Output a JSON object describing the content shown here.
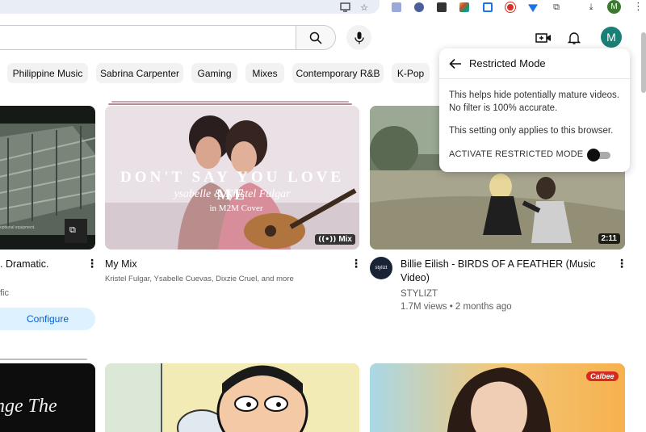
{
  "header": {
    "search_placeholder": "",
    "avatar_letter": "M",
    "profile_letter": "M"
  },
  "chips": [
    "Philippine Music",
    "Sabrina Carpenter",
    "Gaming",
    "Mixes",
    "Contemporary R&B",
    "K-Pop"
  ],
  "cards": [
    {
      "title": ". Dramatic.",
      "meta": "fic",
      "action": "Configure",
      "thumb_caption": "optional equipment."
    },
    {
      "title": "My Mix",
      "meta": "Kristel Fulgar, Ysabelle Cuevas, Dixzie Cruel, and more",
      "badge": "Mix",
      "overlay_line1": "DON'T SAY YOU LOVE ME",
      "overlay_line2": "ysabelle & Kristel Fulgar",
      "overlay_line3": "in M2M Cover"
    },
    {
      "title": "Billie Eilish - BIRDS OF A FEATHER (Music Video)",
      "channel": "STYLIZT",
      "stats": "1.7M views • 2 months ago",
      "duration": "2:11",
      "channel_avatar_text": "stylizt"
    }
  ],
  "row2": {
    "card1_text": "nge The",
    "card4_brand": "Calbee"
  },
  "popup": {
    "title": "Restricted Mode",
    "text1": "This helps hide potentially mature videos. No filter is 100% accurate.",
    "text2": "This setting only applies to this browser.",
    "activate_label": "ACTIVATE RESTRICTED MODE",
    "activated": false
  },
  "colors": {
    "popup_bg": "#ffffff",
    "configure_bg": "#def1ff",
    "configure_text": "#065fd4"
  }
}
